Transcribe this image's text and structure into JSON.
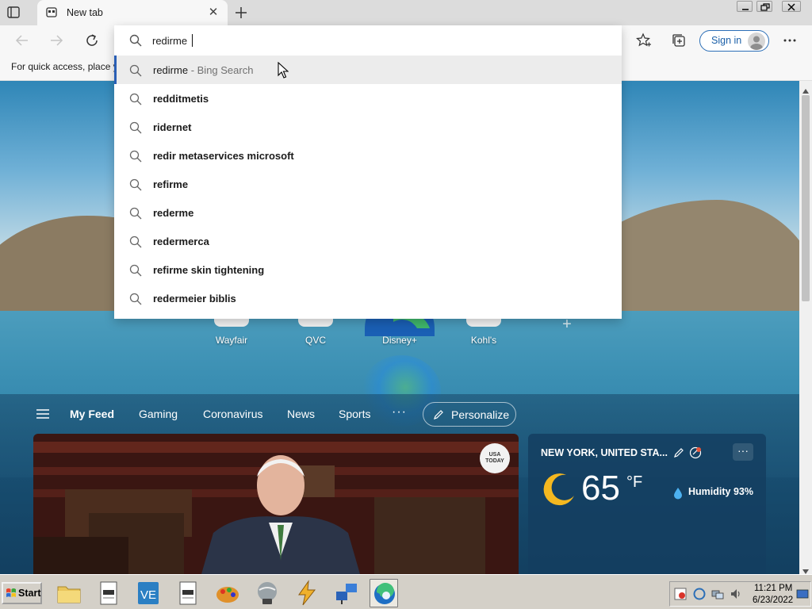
{
  "browser": {
    "tab": {
      "title": "New tab"
    },
    "toolbar": {
      "sign_in_label": "Sign in"
    },
    "favorites_bar": {
      "hint": "For quick access, place y"
    }
  },
  "address_bar": {
    "query": "redirme",
    "suggestions": [
      {
        "text": "redirme",
        "suffix": " - Bing Search",
        "highlighted": true
      },
      {
        "text": "redditmetis"
      },
      {
        "text": "ridernet"
      },
      {
        "text": "redir metaservices microsoft"
      },
      {
        "text": "refirme"
      },
      {
        "text": "rederme"
      },
      {
        "text": "redermerca"
      },
      {
        "text": "refirme skin tightening"
      },
      {
        "text": "redermeier biblis"
      }
    ]
  },
  "new_tab_page": {
    "quick_links": [
      "Wayfair",
      "QVC",
      "Disney+",
      "Kohl's"
    ],
    "feed": {
      "tabs": [
        "My Feed",
        "Gaming",
        "Coronavirus",
        "News",
        "Sports"
      ],
      "more": "···",
      "personalize_label": "Personalize"
    },
    "news_card": {
      "source_badge": [
        "USA",
        "TODAY"
      ]
    },
    "weather": {
      "location": "NEW YORK, UNITED STA...",
      "temperature": "65",
      "unit": "°F",
      "humidity": "Humidity 93%",
      "menu": "···"
    }
  },
  "taskbar": {
    "start_label": "Start",
    "clock_time": "11:21 PM",
    "clock_date": "6/23/2022"
  },
  "colors": {
    "accent": "#2a5fb5",
    "signin_border": "#2c6fb7",
    "taskbar": "#d4d0c8"
  }
}
